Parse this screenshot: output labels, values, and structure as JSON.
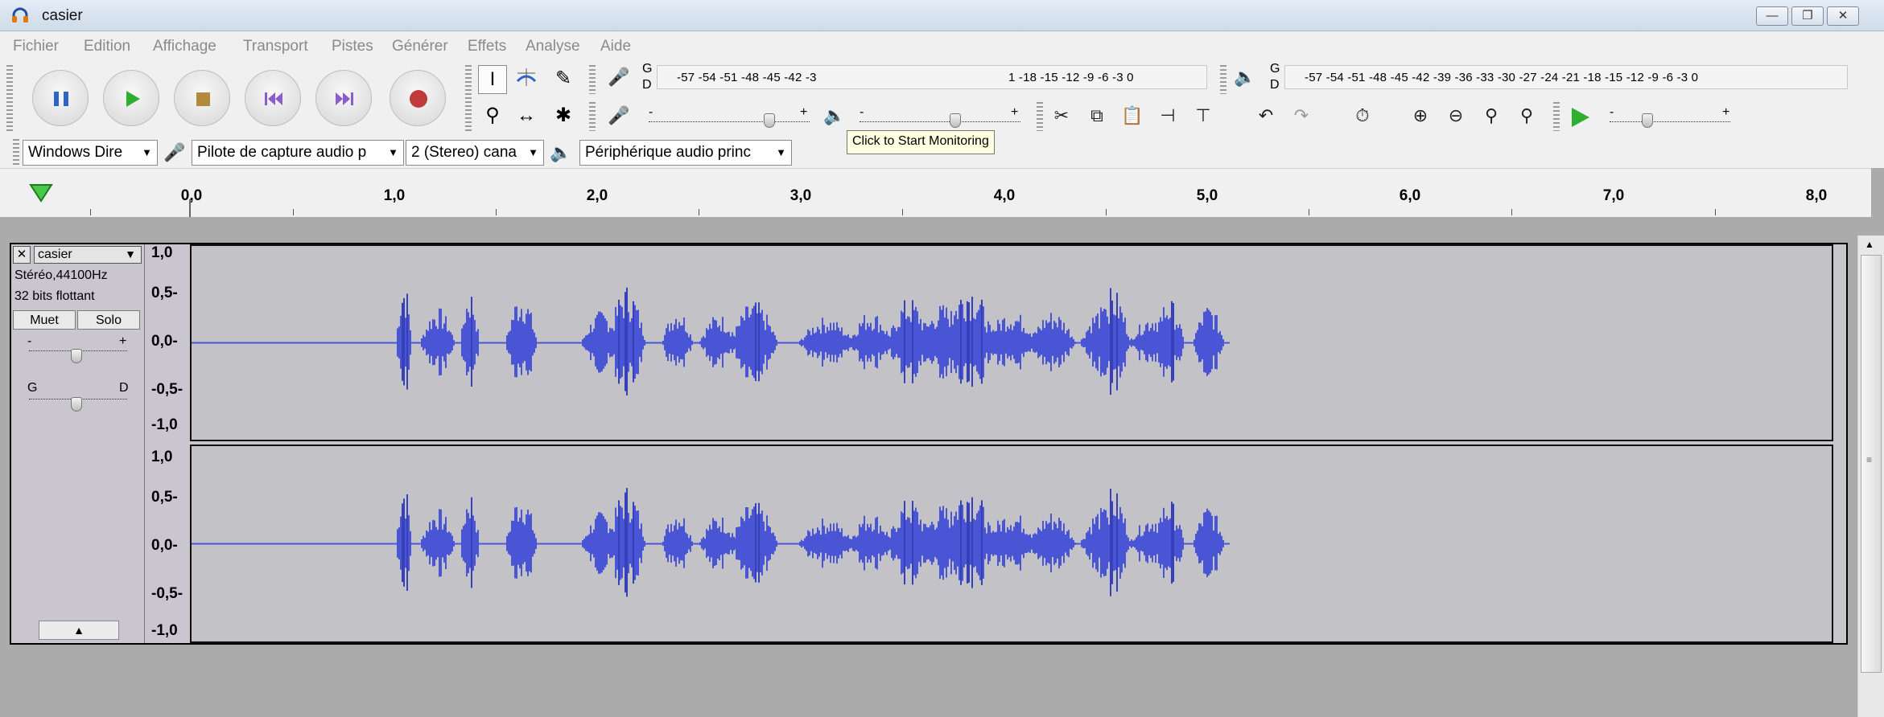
{
  "window": {
    "title": "casier"
  },
  "menu": [
    "Fichier",
    "Edition",
    "Affichage",
    "Transport",
    "Pistes",
    "Générer",
    "Effets",
    "Analyse",
    "Aide"
  ],
  "meters": {
    "record_label_top": "G",
    "record_label_bottom": "D",
    "scale": "-57 -54 -51 -48 -45 -42 -39 -36 -33 -30 -27 -24 -21 -18 -15 -12 -9 -6 -3 0",
    "record_scale_left": "-57 -54 -51 -48 -45 -42 -3",
    "record_scale_right": "1 -18 -15 -12 -9 -6 -3 0",
    "tooltip": "Click to Start Monitoring",
    "slider_minus": "-",
    "slider_plus": "+"
  },
  "devices": {
    "host": "Windows Dire",
    "input": "Pilote de capture audio p",
    "channels": "2 (Stereo) cana",
    "output": "Périphérique audio princ"
  },
  "ruler": {
    "labels": [
      "0,0",
      "1,0",
      "2,0",
      "3,0",
      "4,0",
      "5,0",
      "6,0",
      "7,0",
      "8,0"
    ]
  },
  "track": {
    "name": "casier",
    "format": "Stéréo,44100Hz",
    "bits": "32 bits flottant",
    "mute": "Muet",
    "solo": "Solo",
    "gain_minus": "-",
    "gain_plus": "+",
    "pan_left": "G",
    "pan_right": "D",
    "scale": [
      "1,0",
      "0,5-",
      "0,0-",
      "-0,5-",
      "-1,0"
    ]
  },
  "colors": {
    "waveform": "#4a55d6",
    "waveform_dark": "#3640b8",
    "accent_green": "#2fae2f",
    "record_red": "#c0393b"
  }
}
